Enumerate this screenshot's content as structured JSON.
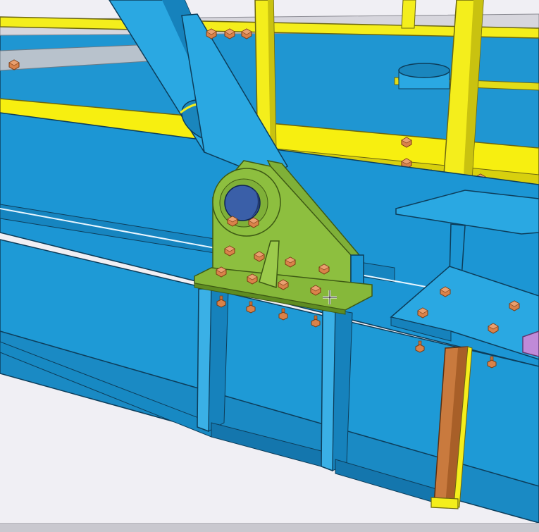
{
  "viewport": {
    "background": "#f0eff4",
    "cursor": "crosshair-cursor-icon"
  },
  "colors": {
    "steel_blue": "#1e9ad6",
    "steel_blue_dark": "#1378b0",
    "steel_blue_light": "#3ab0e6",
    "handrail_yellow": "#f4ee1c",
    "handrail_yellow_dark": "#c9c210",
    "bracket_green": "#86b83a",
    "bracket_green_dark": "#5e8c22",
    "bolt_orange": "#d9824a",
    "pin_blue": "#3a5fa8",
    "column_orange": "#c97a3e",
    "accent_purple": "#c08ad8",
    "edge": "#0d3d5a"
  },
  "model": {
    "objects": [
      "steel-beam",
      "diagonal-brace",
      "gusset-bracket",
      "pin-connection",
      "handrail",
      "column",
      "bolts"
    ]
  }
}
